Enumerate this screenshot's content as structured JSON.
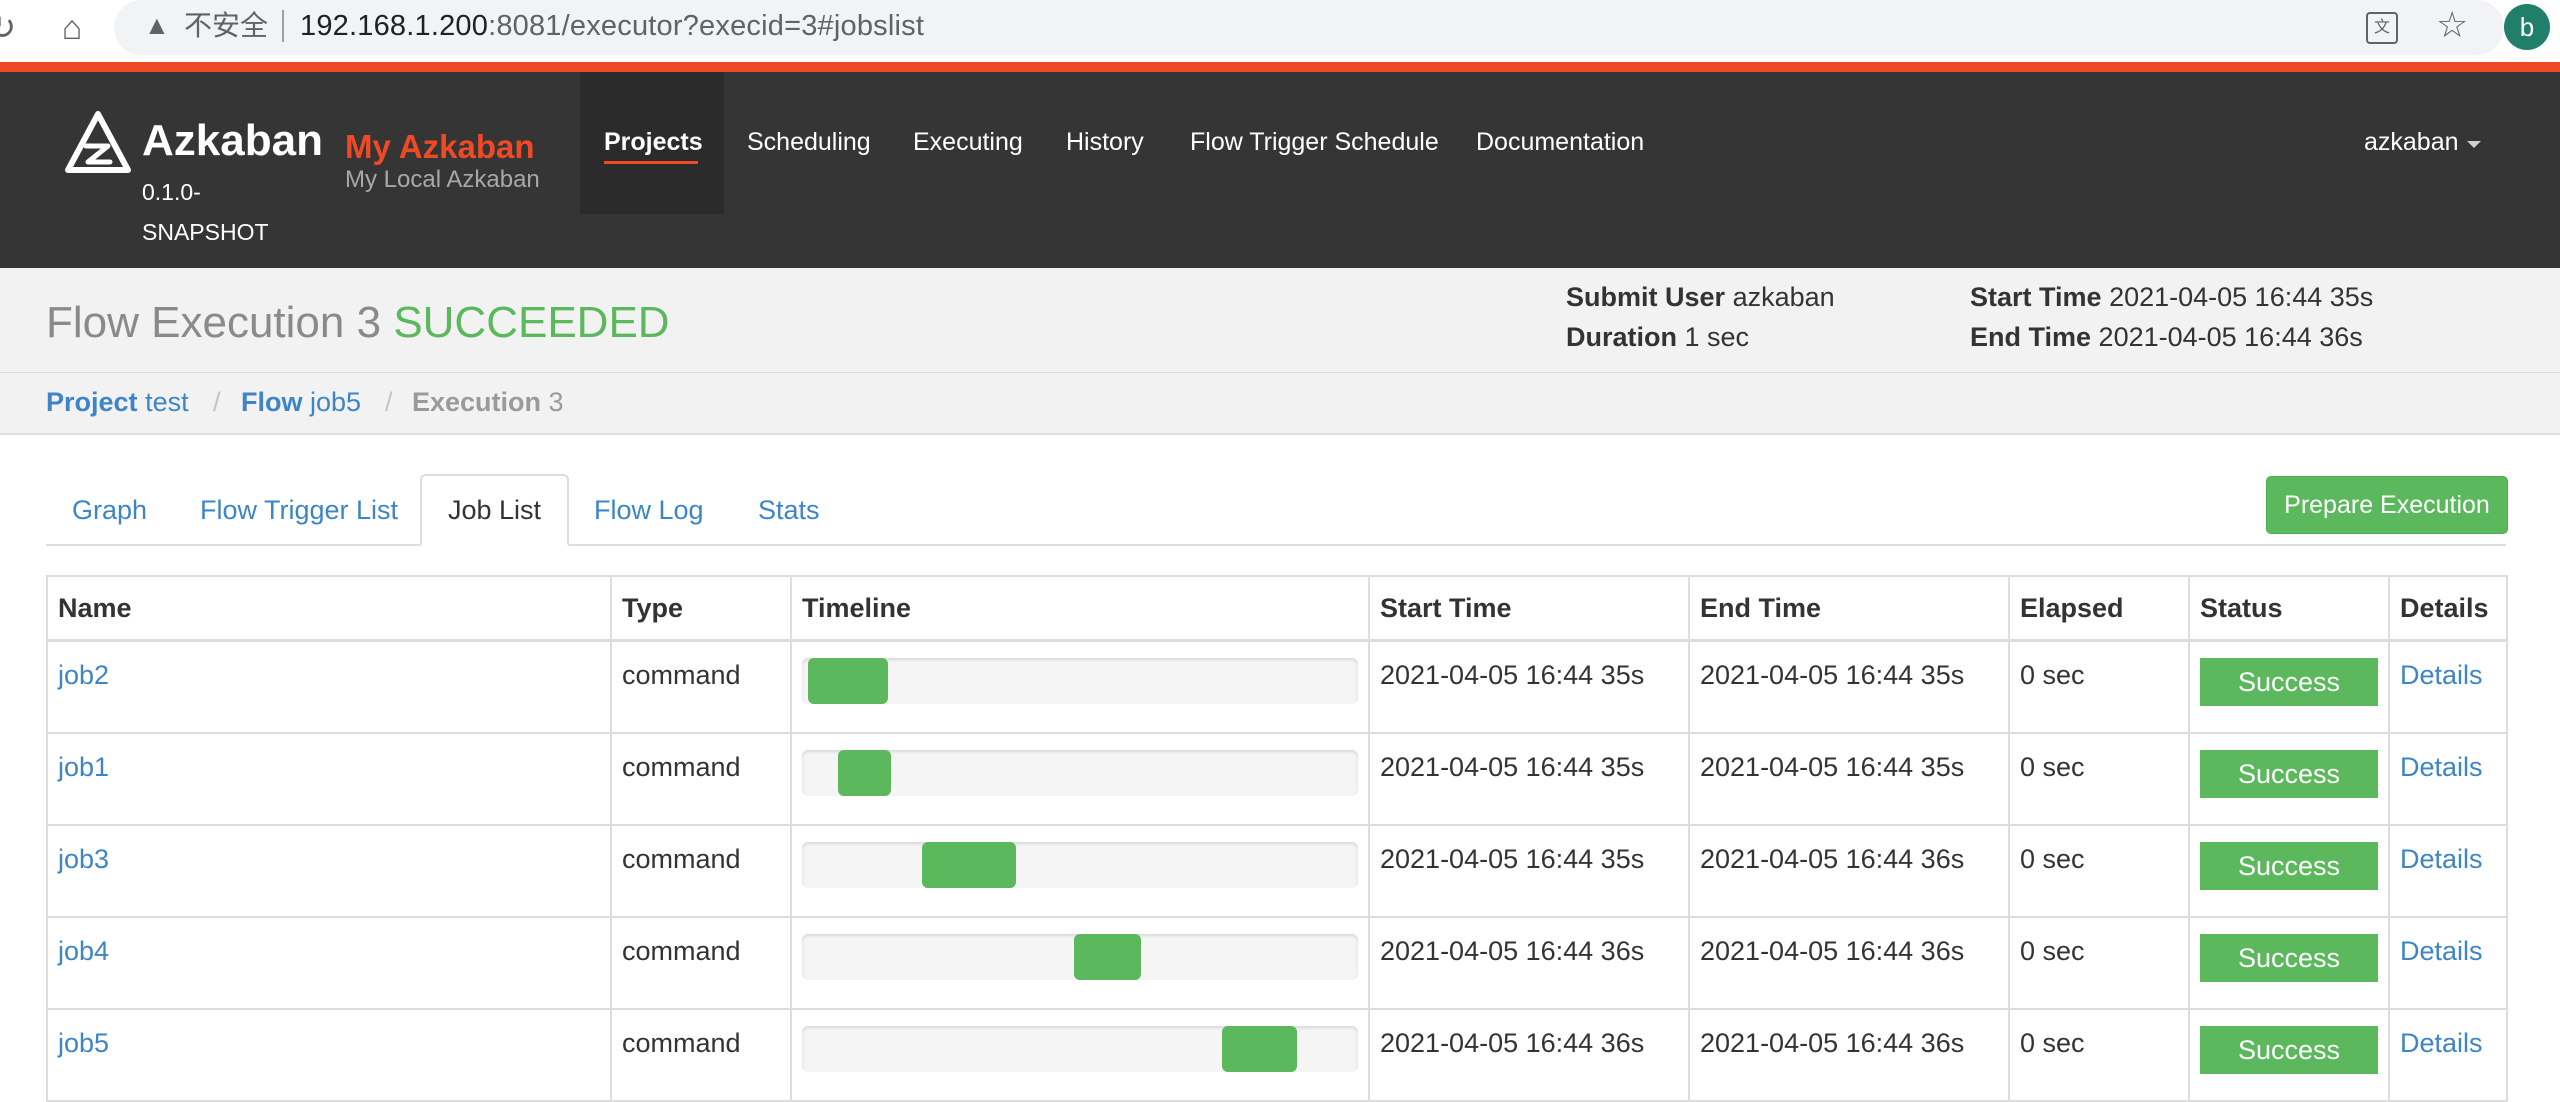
{
  "browser": {
    "insecure_label": "不安全",
    "url_host": "192.168.1.200",
    "url_rest": ":8081/executor?execid=3#jobslist",
    "profile_initial": "b"
  },
  "header": {
    "brand_name": "Azkaban",
    "brand_version": "0.1.0-SNAPSHOT",
    "site_name": "My Azkaban",
    "site_desc": "My Local Azkaban",
    "nav": [
      "Projects",
      "Scheduling",
      "Executing",
      "History",
      "Flow Trigger Schedule",
      "Documentation"
    ],
    "active_nav": "Projects",
    "user": "azkaban"
  },
  "execution": {
    "title_prefix": "Flow Execution",
    "exec_id": "3",
    "status": "SUCCEEDED",
    "submit_user_label": "Submit User",
    "submit_user": "azkaban",
    "duration_label": "Duration",
    "duration": "1 sec",
    "start_time_label": "Start Time",
    "start_time": "2021-04-05 16:44 35s",
    "end_time_label": "End Time",
    "end_time": "2021-04-05 16:44 36s"
  },
  "breadcrumb": {
    "project_label": "Project",
    "project": "test",
    "flow_label": "Flow",
    "flow": "job5",
    "execution_label": "Execution",
    "execution": "3",
    "separator": "/"
  },
  "tabs": [
    "Graph",
    "Flow Trigger List",
    "Job List",
    "Flow Log",
    "Stats"
  ],
  "active_tab": "Job List",
  "prepare_button": "Prepare Execution",
  "table": {
    "columns": [
      "Name",
      "Type",
      "Timeline",
      "Start Time",
      "End Time",
      "Elapsed",
      "Status",
      "Details"
    ],
    "rows": [
      {
        "name": "job2",
        "type": "command",
        "timeline_start": 0.01,
        "timeline_end": 0.155,
        "start": "2021-04-05 16:44 35s",
        "end": "2021-04-05 16:44 35s",
        "elapsed": "0 sec",
        "status": "Success",
        "details": "Details"
      },
      {
        "name": "job1",
        "type": "command",
        "timeline_start": 0.065,
        "timeline_end": 0.16,
        "start": "2021-04-05 16:44 35s",
        "end": "2021-04-05 16:44 35s",
        "elapsed": "0 sec",
        "status": "Success",
        "details": "Details"
      },
      {
        "name": "job3",
        "type": "command",
        "timeline_start": 0.215,
        "timeline_end": 0.385,
        "start": "2021-04-05 16:44 35s",
        "end": "2021-04-05 16:44 36s",
        "elapsed": "0 sec",
        "status": "Success",
        "details": "Details"
      },
      {
        "name": "job4",
        "type": "command",
        "timeline_start": 0.49,
        "timeline_end": 0.61,
        "start": "2021-04-05 16:44 36s",
        "end": "2021-04-05 16:44 36s",
        "elapsed": "0 sec",
        "status": "Success",
        "details": "Details"
      },
      {
        "name": "job5",
        "type": "command",
        "timeline_start": 0.755,
        "timeline_end": 0.89,
        "start": "2021-04-05 16:44 36s",
        "end": "2021-04-05 16:44 36s",
        "elapsed": "0 sec",
        "status": "Success",
        "details": "Details"
      }
    ]
  },
  "colors": {
    "accent": "#ee4a25",
    "success": "#5cb85c",
    "link": "#3d85c6",
    "header_bg": "#353535"
  }
}
